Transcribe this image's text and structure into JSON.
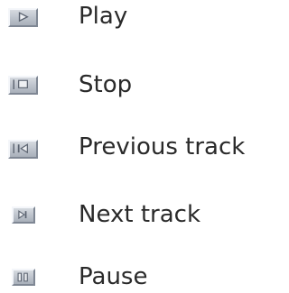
{
  "legend": {
    "items": [
      {
        "icon": "play-icon",
        "label": "Play"
      },
      {
        "icon": "stop-icon",
        "label": "Stop"
      },
      {
        "icon": "previous-track-icon",
        "label": "Previous track"
      },
      {
        "icon": "next-track-icon",
        "label": "Next track"
      },
      {
        "icon": "pause-icon",
        "label": "Pause"
      }
    ]
  },
  "colors": {
    "text": "#2a2a2a",
    "button_face": "#bcc2cb",
    "glyph": "#5b6370"
  }
}
